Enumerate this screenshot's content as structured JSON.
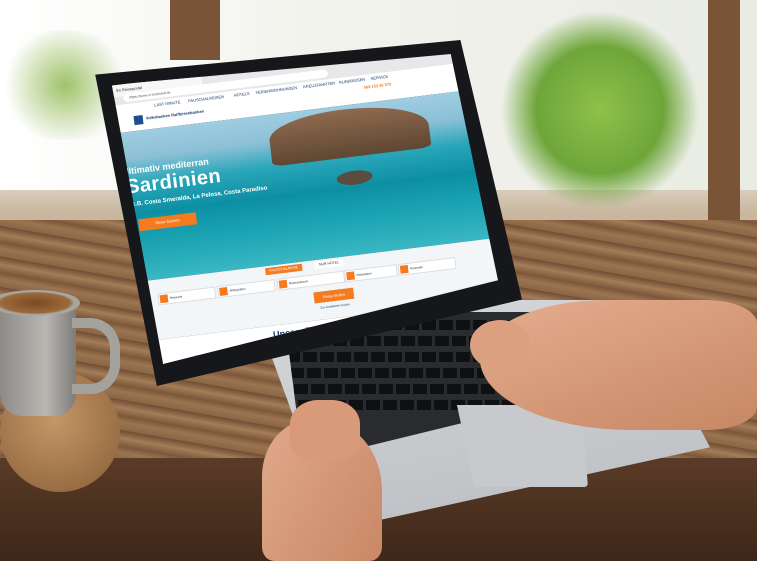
{
  "browser": {
    "tab_title": "Ihr Reiseportal",
    "url": "https://www.vr-reisewelt.de"
  },
  "site": {
    "logo_text": "Volksbanken Raiffeisenbanken",
    "nav": [
      "LAST MINUTE",
      "PAUSCHALREISEN",
      "HOTELS",
      "FERIENWOHNUNGEN",
      "KREUZFAHRTEN",
      "RUNDREISEN",
      "SERVICE"
    ],
    "hotline": "069 153 40 575"
  },
  "hero": {
    "pre_title": "Ultimativ mediterran",
    "title": "Sardinien",
    "subtitle": "z.B. Costa Smeralda, La Pelosa, Costa Paradiso",
    "cta_label": "Reise buchen"
  },
  "search": {
    "tabs": [
      "PAUSCHALREISE",
      "NUR HOTEL"
    ],
    "fields": [
      "Reiseziel",
      "Abflughafen",
      "Reisezeitraum",
      "Reisedauer",
      "Reisende"
    ],
    "button_label": "Reise finden",
    "advanced_link": "Zur erweiterten Suche"
  },
  "offers": {
    "title": "Unsere Top-Angebote",
    "cards": [
      "",
      "",
      ""
    ]
  },
  "colors": {
    "accent": "#f47b20",
    "brand_blue": "#1a3d6b",
    "sea": "#0d8fa3"
  }
}
